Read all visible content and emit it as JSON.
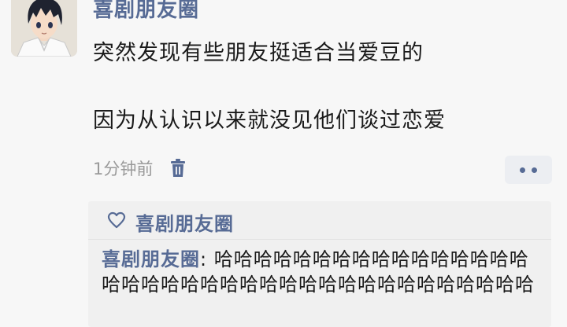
{
  "post": {
    "author": "喜剧朋友圈",
    "lines": [
      "突然发现有些朋友挺适合当爱豆的",
      "",
      "因为从认识以来就没见他们谈过恋爱"
    ],
    "time": "1分钟前"
  },
  "likes": {
    "names": "喜剧朋友圈"
  },
  "comments": [
    {
      "author": "喜剧朋友圈",
      "separator": ": ",
      "text": "哈哈哈哈哈哈哈哈哈哈哈哈哈哈哈哈哈哈哈哈哈哈哈哈哈哈哈哈哈哈哈哈哈哈哈哈哈哈"
    }
  ],
  "icons": {
    "avatar": "anime-avatar",
    "delete": "trash-icon",
    "more": "more-dots-icon",
    "like": "heart-outline-icon"
  },
  "colors": {
    "link": "#576b95",
    "text": "#1a1a1a",
    "muted": "#9a9a9a",
    "panel": "#f0f0f0",
    "background": "#f7f7f7"
  }
}
